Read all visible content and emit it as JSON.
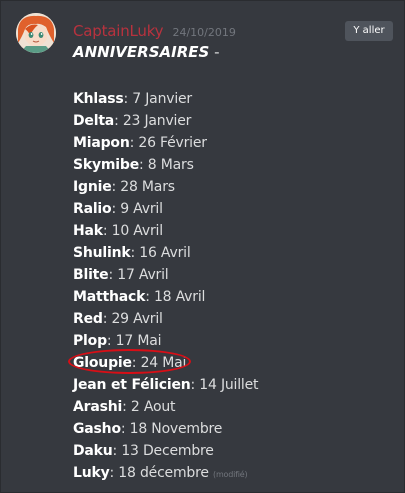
{
  "message": {
    "author": "CaptainLuky",
    "timestamp": "24/10/2019",
    "jump_label": "Y aller",
    "heading": "ANNIVERSAIRES",
    "heading_suffix": " -",
    "edited_label": "(modifié)",
    "entries": [
      {
        "name": "Khlass",
        "date": ": 7 Janvier"
      },
      {
        "name": "Delta",
        "date": ": 23 Janvier"
      },
      {
        "name": "Miapon",
        "date": ": 26 Février"
      },
      {
        "name": "Skymibe",
        "date": ": 8 Mars"
      },
      {
        "name": "Ignie",
        "date": ": 28 Mars"
      },
      {
        "name": "Ralio",
        "date": ": 9 Avril"
      },
      {
        "name": "Hak",
        "date": ": 10 Avril"
      },
      {
        "name": "Shulink",
        "date": ": 16 Avril"
      },
      {
        "name": "Blite",
        "date": ": 17 Avril"
      },
      {
        "name": "Matthack",
        "date": ": 18 Avril"
      },
      {
        "name": "Red",
        "date": ": 29 Avril"
      },
      {
        "name": "Plop",
        "date": ": 17 Mai"
      },
      {
        "name": "Gloupie",
        "date": ": 24 Mai"
      },
      {
        "name": "Jean et Félicien",
        "date": ": 14 Juillet"
      },
      {
        "name": "Arashi",
        "date": ": 2 Aout"
      },
      {
        "name": "Gasho",
        "date": ": 18 Novembre"
      },
      {
        "name": "Daku",
        "date": ": 13 Decembre"
      },
      {
        "name": "Luky",
        "date": ": 18 décembre"
      }
    ]
  },
  "colors": {
    "background": "#36393f",
    "author_name": "#b8323e",
    "highlight_circle": "#d80e16",
    "body_text": "#dcddde",
    "bold_text": "#ffffff",
    "muted_text": "#72767d",
    "button_bg": "#4f545c"
  }
}
